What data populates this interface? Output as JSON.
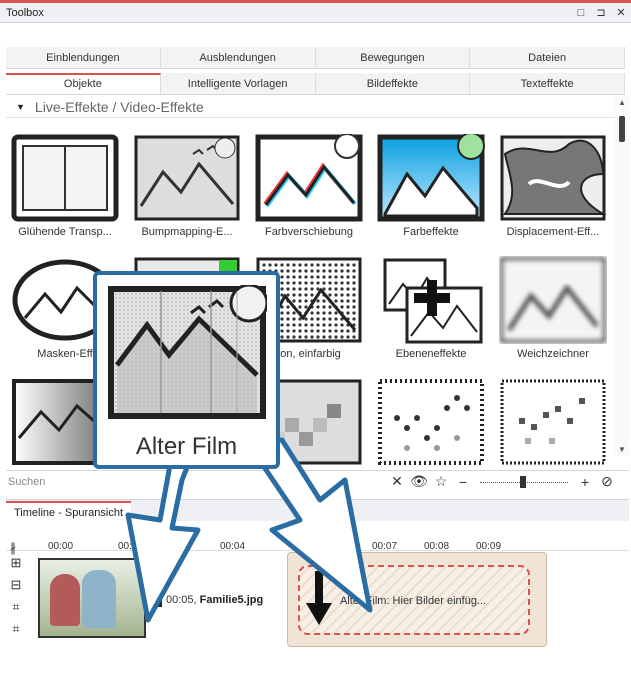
{
  "window": {
    "title": "Toolbox",
    "controls": [
      "□",
      "⊐",
      "✕"
    ]
  },
  "tabs_row1": [
    "Einblendungen",
    "Ausblendungen",
    "Bewegungen",
    "Dateien"
  ],
  "tabs_row2": [
    "Objekte",
    "Intelligente Vorlagen",
    "Bildeffekte",
    "Texteffekte"
  ],
  "section": {
    "title": "Live-Effekte / Video-Effekte"
  },
  "effects": [
    "Glühende Transp...",
    "Bumpmapping-E...",
    "Farbverschiebung",
    "Farbeffekte",
    "Displacement-Eff...",
    "Masken-Eff",
    "",
    "ton, einfarbig",
    "Ebeneneffekte",
    "Weichzeichner",
    "",
    "",
    "",
    "",
    ""
  ],
  "search": {
    "placeholder": "Suchen"
  },
  "tooltip": {
    "label": "Alter Film"
  },
  "timeline": {
    "tab": "Timeline - Spuransicht",
    "ticks": [
      "00:00",
      "00:02",
      "00:04",
      "00:07",
      "00:08",
      "00:09"
    ],
    "clip1": {
      "time": "00:05,",
      "file": "Familie5.jpg"
    },
    "clip2": {
      "text": "Alter Film: Hier Bilder einfüg..."
    }
  },
  "colors": {
    "accent": "#d9534f",
    "tooltip_border": "#2b6ca3",
    "arrow_fill": "#ffffff",
    "arrow_stroke": "#2b6ca3"
  }
}
